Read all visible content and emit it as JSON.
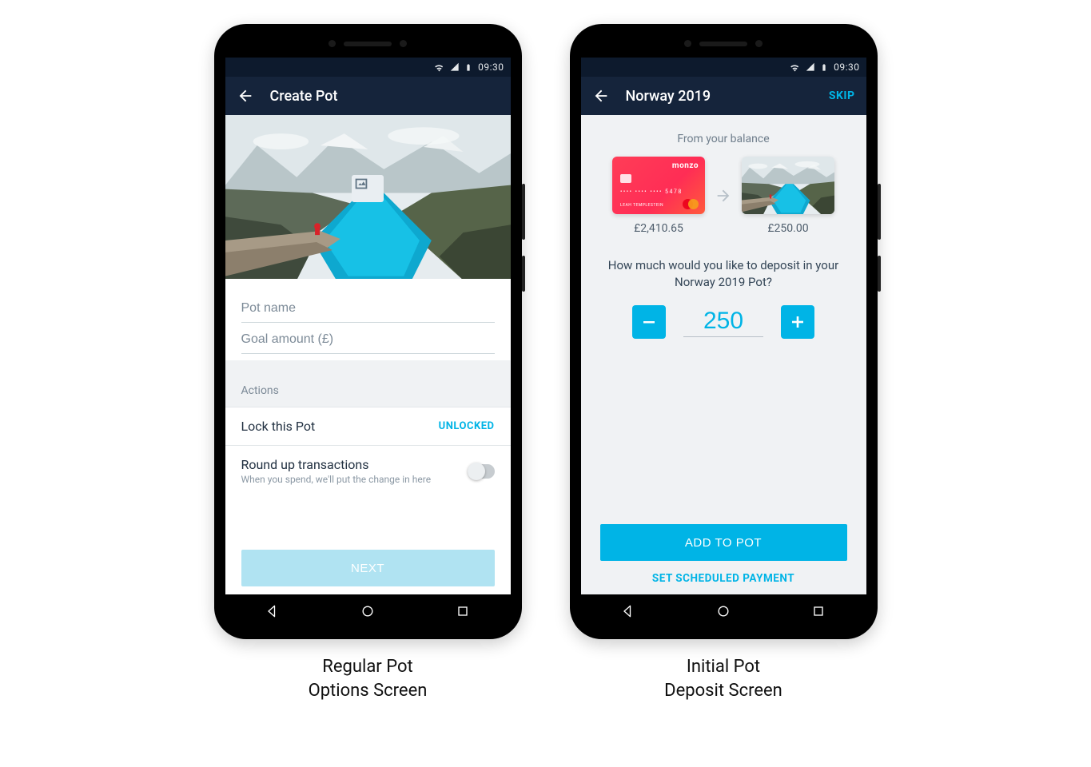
{
  "status_bar": {
    "time": "09:30"
  },
  "screen1": {
    "title": "Create Pot",
    "pot_name_placeholder": "Pot name",
    "goal_amount_placeholder": "Goal amount (£)",
    "actions_header": "Actions",
    "lock_row": {
      "label": "Lock this Pot",
      "status": "UNLOCKED"
    },
    "roundup_row": {
      "label": "Round up transactions",
      "sub": "When you spend, we'll put the change in here"
    },
    "next_button": "NEXT"
  },
  "screen2": {
    "title": "Norway 2019",
    "skip": "SKIP",
    "from_label": "From your balance",
    "balance": "£2,410.65",
    "pot_balance": "£250.00",
    "prompt": "How much would you like to deposit in your Norway 2019 Pot?",
    "amount_value": "250",
    "add_button": "ADD TO POT",
    "schedule_button": "SET SCHEDULED PAYMENT",
    "card_brand": "monzo",
    "card_number_masked": "•••• •••• •••• 5478",
    "card_name": "LEAH TEMPLESTEIN"
  },
  "captions": {
    "left_line1": "Regular Pot",
    "left_line2": "Options Screen",
    "right_line1": "Initial Pot",
    "right_line2": "Deposit Screen"
  }
}
